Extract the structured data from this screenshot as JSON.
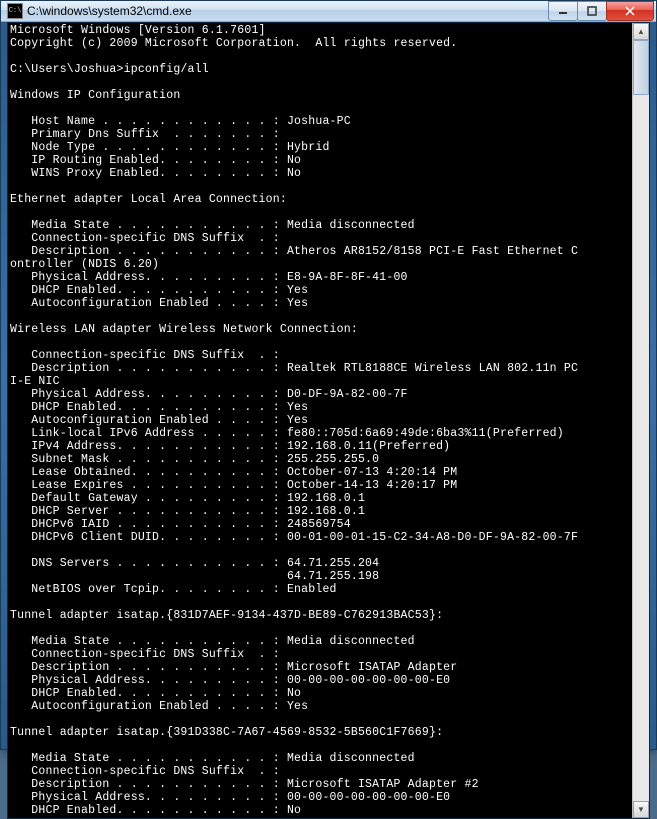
{
  "titlebar": {
    "icon_label": "C:\\",
    "path": "C:\\windows\\system32\\cmd.exe"
  },
  "console": {
    "header": {
      "line1": "Microsoft Windows [Version 6.1.7601]",
      "line2": "Copyright (c) 2009 Microsoft Corporation.  All rights reserved."
    },
    "prompt": "C:\\Users\\Joshua>ipconfig/all",
    "heading_ipconfig": "Windows IP Configuration",
    "ipconfig": {
      "host_name": "   Host Name . . . . . . . . . . . . : Joshua-PC",
      "primary_dns_suffix": "   Primary Dns Suffix  . . . . . . . :",
      "node_type": "   Node Type . . . . . . . . . . . . : Hybrid",
      "ip_routing": "   IP Routing Enabled. . . . . . . . : No",
      "wins_proxy": "   WINS Proxy Enabled. . . . . . . . : No"
    },
    "heading_eth": "Ethernet adapter Local Area Connection:",
    "eth": {
      "media_state": "   Media State . . . . . . . . . . . : Media disconnected",
      "dns_suffix": "   Connection-specific DNS Suffix  . :",
      "description": "   Description . . . . . . . . . . . : Atheros AR8152/8158 PCI-E Fast Ethernet C",
      "desc2": "ontroller (NDIS 6.20)",
      "phys": "   Physical Address. . . . . . . . . : E8-9A-8F-8F-41-00",
      "dhcp": "   DHCP Enabled. . . . . . . . . . . : Yes",
      "autoconf": "   Autoconfiguration Enabled . . . . : Yes"
    },
    "heading_wlan": "Wireless LAN adapter Wireless Network Connection:",
    "wlan": {
      "dns_suffix": "   Connection-specific DNS Suffix  . :",
      "description": "   Description . . . . . . . . . . . : Realtek RTL8188CE Wireless LAN 802.11n PC",
      "desc2": "I-E NIC",
      "phys": "   Physical Address. . . . . . . . . : D0-DF-9A-82-00-7F",
      "dhcp": "   DHCP Enabled. . . . . . . . . . . : Yes",
      "autoconf": "   Autoconfiguration Enabled . . . . : Yes",
      "linklocal": "   Link-local IPv6 Address . . . . . : fe80::705d:6a69:49de:6ba3%11(Preferred)",
      "ipv4": "   IPv4 Address. . . . . . . . . . . : 192.168.0.11(Preferred)",
      "subnet": "   Subnet Mask . . . . . . . . . . . : 255.255.255.0",
      "lease_ob": "   Lease Obtained. . . . . . . . . . : October-07-13 4:20:14 PM",
      "lease_ex": "   Lease Expires . . . . . . . . . . : October-14-13 4:20:17 PM",
      "gateway": "   Default Gateway . . . . . . . . . : 192.168.0.1",
      "dhcp_srv": "   DHCP Server . . . . . . . . . . . : 192.168.0.1",
      "iaid": "   DHCPv6 IAID . . . . . . . . . . . : 248569754",
      "duid": "   DHCPv6 Client DUID. . . . . . . . : 00-01-00-01-15-C2-34-A8-D0-DF-9A-82-00-7F",
      "dns1": "   DNS Servers . . . . . . . . . . . : 64.71.255.204",
      "dns2": "                                       64.71.255.198",
      "netbios": "   NetBIOS over Tcpip. . . . . . . . : Enabled"
    },
    "heading_tun1": "Tunnel adapter isatap.{831D7AEF-9134-437D-BE89-C762913BAC53}:",
    "tun1": {
      "media_state": "   Media State . . . . . . . . . . . : Media disconnected",
      "dns_suffix": "   Connection-specific DNS Suffix  . :",
      "description": "   Description . . . . . . . . . . . : Microsoft ISATAP Adapter",
      "phys": "   Physical Address. . . . . . . . . : 00-00-00-00-00-00-00-E0",
      "dhcp": "   DHCP Enabled. . . . . . . . . . . : No",
      "autoconf": "   Autoconfiguration Enabled . . . . : Yes"
    },
    "heading_tun2": "Tunnel adapter isatap.{391D338C-7A67-4569-8532-5B560C1F7669}:",
    "tun2": {
      "media_state": "   Media State . . . . . . . . . . . : Media disconnected",
      "dns_suffix": "   Connection-specific DNS Suffix  . :",
      "description": "   Description . . . . . . . . . . . : Microsoft ISATAP Adapter #2",
      "phys": "   Physical Address. . . . . . . . . : 00-00-00-00-00-00-00-E0",
      "dhcp": "   DHCP Enabled. . . . . . . . . . . : No"
    }
  }
}
